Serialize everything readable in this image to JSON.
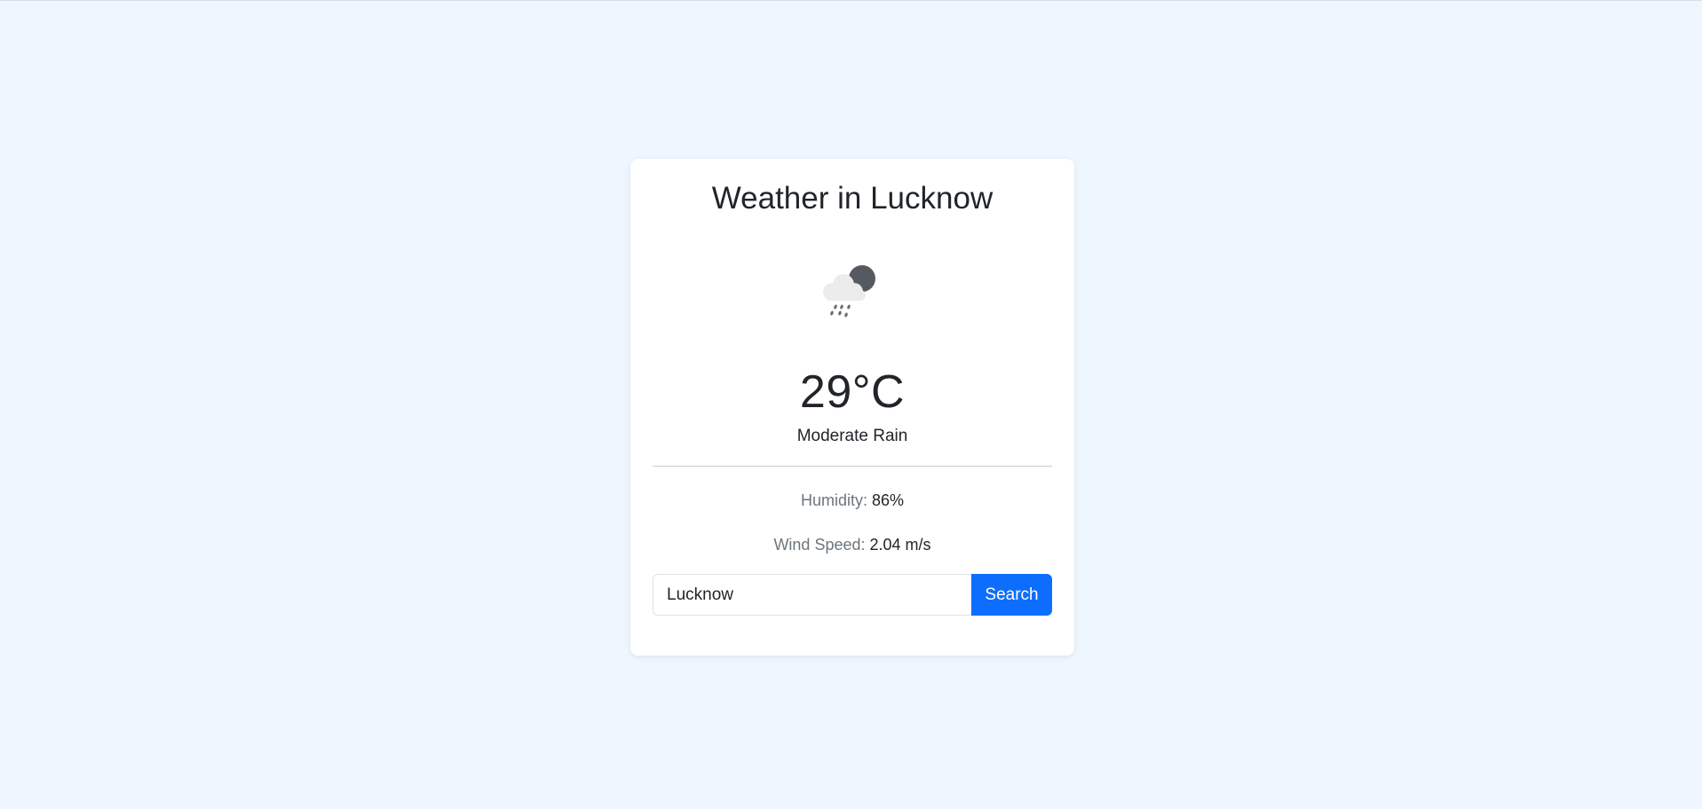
{
  "card": {
    "title": "Weather in Lucknow",
    "icon": "moderate-rain-night-icon",
    "temperature": "29°C",
    "condition": "Moderate Rain",
    "humidity": {
      "label": "Humidity:",
      "value": "86%"
    },
    "wind": {
      "label": "Wind Speed:",
      "value": "2.04 m/s"
    }
  },
  "search": {
    "value": "Lucknow",
    "button_label": "Search"
  },
  "colors": {
    "page_background": "#eef7ff",
    "card_background": "#ffffff",
    "accent": "#0d6efd",
    "muted_text": "#6c757d"
  }
}
